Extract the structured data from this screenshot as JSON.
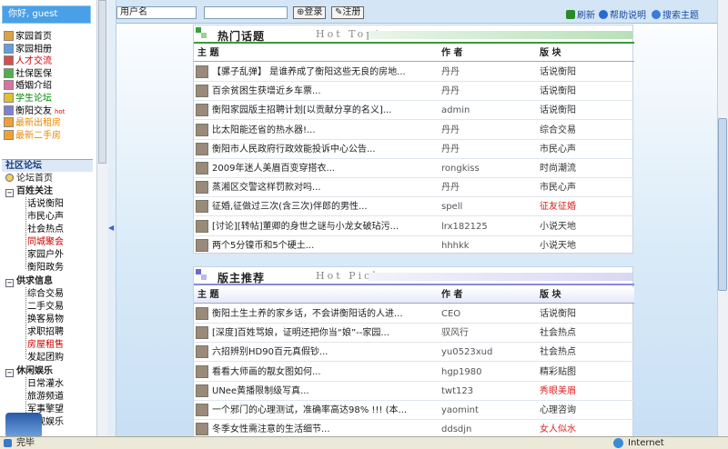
{
  "greeting": "你好, guest",
  "nav": [
    {
      "label": "家园首页",
      "color": "#000000"
    },
    {
      "label": "家园相册",
      "color": "#000000"
    },
    {
      "label": "人才交流",
      "color": "#cc0000"
    },
    {
      "label": "社保医保",
      "color": "#000000"
    },
    {
      "label": "婚姻介绍",
      "color": "#000000"
    },
    {
      "label": "学生论坛",
      "color": "#008800"
    },
    {
      "label": "衡阳交友",
      "color": "#000000",
      "badge": "hot"
    },
    {
      "label": "最新出租房",
      "color": "#ee8800"
    },
    {
      "label": "最新二手房",
      "color": "#ee8800"
    }
  ],
  "forum": {
    "title": "社区论坛",
    "home": "论坛首页",
    "groups": [
      {
        "label": "百姓关注",
        "items": [
          {
            "label": "话说衡阳",
            "color": "#000000"
          },
          {
            "label": "市民心声",
            "color": "#000000"
          },
          {
            "label": "社会热点",
            "color": "#000000"
          },
          {
            "label": "同城聚会",
            "color": "#cc0000"
          },
          {
            "label": "家园户外",
            "color": "#000000"
          },
          {
            "label": "衡阳政务",
            "color": "#000000"
          }
        ]
      },
      {
        "label": "供求信息",
        "items": [
          {
            "label": "综合交易",
            "color": "#000000"
          },
          {
            "label": "二手交易",
            "color": "#000000"
          },
          {
            "label": "换客易物",
            "color": "#000000"
          },
          {
            "label": "求职招聘",
            "color": "#000000"
          },
          {
            "label": "房屋租售",
            "color": "#cc0000"
          },
          {
            "label": "发起团购",
            "color": "#000000"
          }
        ]
      },
      {
        "label": "休闲娱乐",
        "items": [
          {
            "label": "日常灌水",
            "color": "#000000"
          },
          {
            "label": "旅游频道",
            "color": "#000000"
          },
          {
            "label": "军事擎望",
            "color": "#000000"
          },
          {
            "label": "影视娱乐",
            "color": "#000000"
          }
        ]
      }
    ]
  },
  "topbar": {
    "username_placeholder": "用户名",
    "login": "登录",
    "register": "注册",
    "refresh": "刷新",
    "help": "帮助说明",
    "search": "搜索主题"
  },
  "hot": {
    "title_cn": "热门话题",
    "title_en": "Hot Topic",
    "col_subject": "主 题",
    "col_author": "作 者",
    "col_forum": "版 块",
    "rows": [
      {
        "subject": "【骡子乱弹】 是谁养成了衡阳这些无良的房地...",
        "author": "丹丹",
        "forum": "话说衡阳",
        "fc": "#333333"
      },
      {
        "subject": "百余贫困生获增近乡车票...",
        "author": "丹丹",
        "forum": "话说衡阳",
        "fc": "#333333"
      },
      {
        "subject": "衡阳家园版主招聘计划[以贡献分享的名义]...",
        "author": "admin",
        "forum": "话说衡阳",
        "fc": "#333333"
      },
      {
        "subject": "比太阳能还省的热水器!...",
        "author": "丹丹",
        "forum": "综合交易",
        "fc": "#333333"
      },
      {
        "subject": "衡阳市人民政府行政效能投诉中心公告...",
        "author": "丹丹",
        "forum": "市民心声",
        "fc": "#333333"
      },
      {
        "subject": "2009年迷人美眉百变穿搭衣...",
        "author": "rongkiss",
        "forum": "时尚潮流",
        "fc": "#333333"
      },
      {
        "subject": "蒸湘区交警这样罚款对吗...",
        "author": "丹丹",
        "forum": "市民心声",
        "fc": "#333333"
      },
      {
        "subject": "征婚,征做过三次(含三次)伴郎的男性...",
        "author": "spell",
        "forum": "征友征婚",
        "fc": "#dd2222"
      },
      {
        "subject": "[讨论][转帖]董卿的身世之谜与小龙女破玷污...",
        "author": "lrx182125",
        "forum": "小说天地",
        "fc": "#333333"
      },
      {
        "subject": "两个5分镍币和5个硬土...",
        "author": "hhhkk",
        "forum": "小说天地",
        "fc": "#333333"
      }
    ]
  },
  "picks": {
    "title_cn": "版主推荐",
    "title_en": "Hot Picks",
    "col_subject": "主 题",
    "col_author": "作 者",
    "col_forum": "版 块",
    "rows": [
      {
        "subject": "衡阳土生土养的家乡话，不会讲衡阳话的人进...",
        "author": "CEO",
        "forum": "话说衡阳",
        "fc": "#333333"
      },
      {
        "subject": "[深度]百姓骂娘，证明还把你当“娘”--家园...",
        "author": "驭风行",
        "forum": "社会热点",
        "fc": "#333333"
      },
      {
        "subject": "六招辨别HD90百元真假钞...",
        "author": "yu0523xud",
        "forum": "社会热点",
        "fc": "#333333"
      },
      {
        "subject": "看看大师画的靓女图如何...",
        "author": "hgp1980",
        "forum": "精彩贴图",
        "fc": "#333333"
      },
      {
        "subject": "UNee黄播限制级写真...",
        "author": "twt123",
        "forum": "秀眼美眉",
        "fc": "#dd2222"
      },
      {
        "subject": "一个邪门的心理测试，准确率高达98% !!! (本...",
        "author": "yaomint",
        "forum": "心理咨询",
        "fc": "#333333"
      },
      {
        "subject": "冬季女性需注意的生活细节...",
        "author": "ddsdjn",
        "forum": "女人似水",
        "fc": "#dd2222"
      }
    ]
  },
  "status": {
    "done": "完毕",
    "zone": "Internet"
  }
}
